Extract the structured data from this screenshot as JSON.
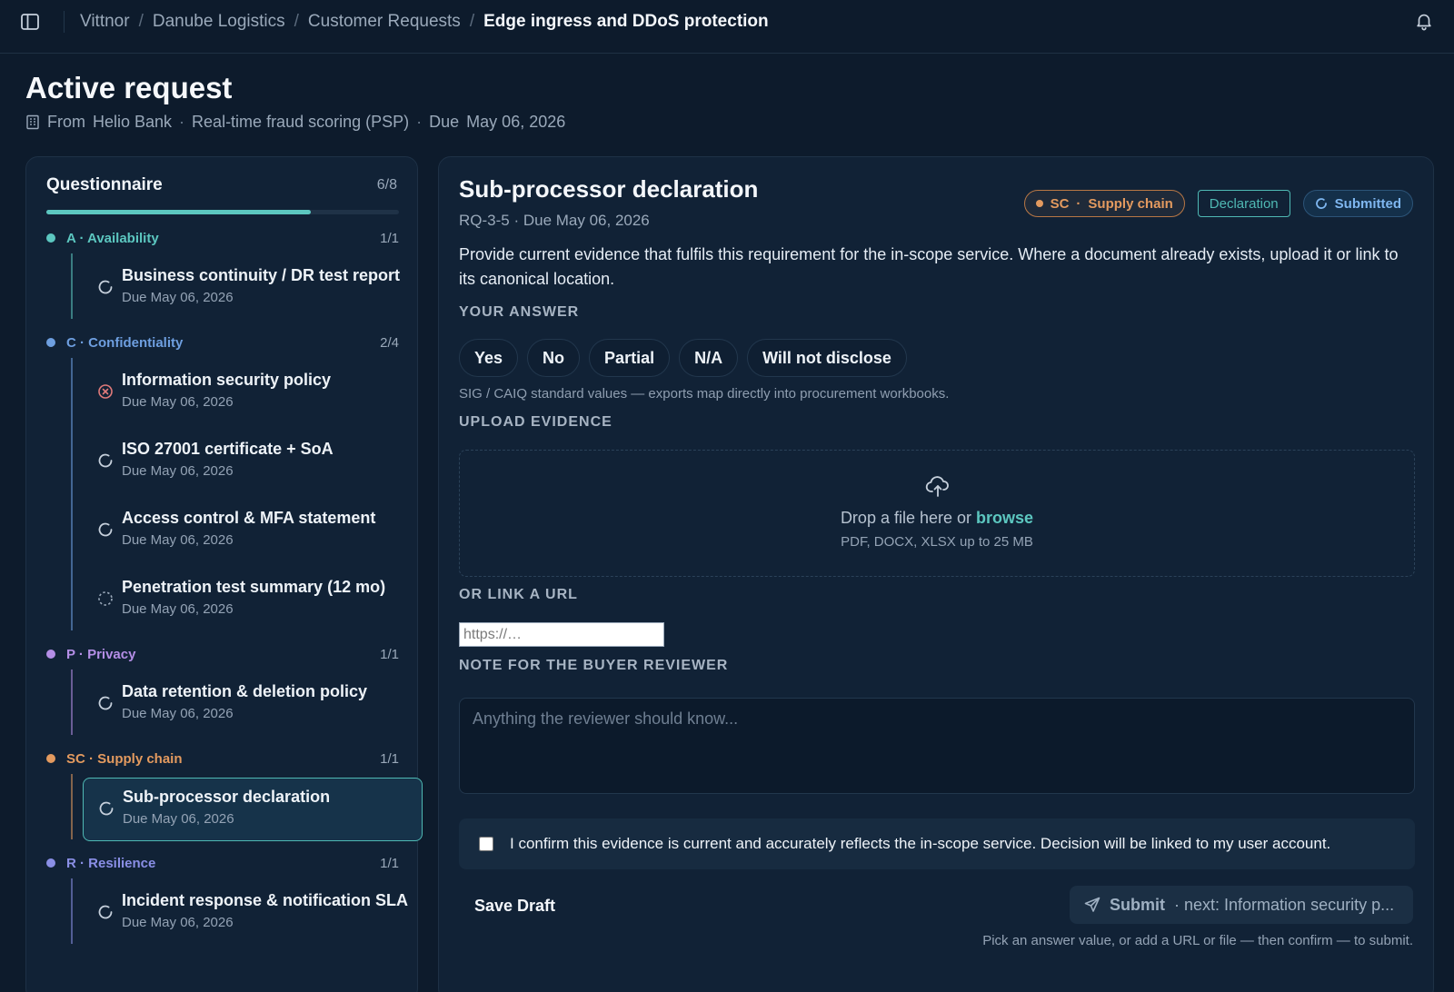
{
  "topbar": {
    "breadcrumbs": [
      "Vittnor",
      "Danube Logistics",
      "Customer Requests"
    ],
    "current": "Edge ingress and DDoS protection"
  },
  "header": {
    "title": "Active request",
    "from_label": "From",
    "from_value": "Helio Bank",
    "service": "Real-time fraud scoring (PSP)",
    "due_label": "Due",
    "due_value": "May 06, 2026"
  },
  "questionnaire": {
    "title": "Questionnaire",
    "count": "6/8",
    "progress": 0.75,
    "groups": [
      {
        "label": "A · Availability",
        "count": "1/1",
        "color": "#5cc7c0",
        "items": [
          {
            "title": "Business continuity / DR test report",
            "due": "Due May 06, 2026",
            "icon": "spinner-icon"
          }
        ]
      },
      {
        "label": "C · Confidentiality",
        "count": "2/4",
        "color": "#6e9fe0",
        "items": [
          {
            "title": "Information security policy",
            "due": "Due May 06, 2026",
            "icon": "x-circle-icon"
          },
          {
            "title": "ISO 27001 certificate + SoA",
            "due": "Due May 06, 2026",
            "icon": "spinner-icon"
          },
          {
            "title": "Access control & MFA statement",
            "due": "Due May 06, 2026",
            "icon": "spinner-icon"
          },
          {
            "title": "Penetration test summary (12 mo)",
            "due": "Due May 06, 2026",
            "icon": "dashed-circle-icon"
          }
        ]
      },
      {
        "label": "P · Privacy",
        "count": "1/1",
        "color": "#b48ee6",
        "items": [
          {
            "title": "Data retention & deletion policy",
            "due": "Due May 06, 2026",
            "icon": "spinner-icon"
          }
        ]
      },
      {
        "label": "SC · Supply chain",
        "count": "1/1",
        "color": "#e39a5f",
        "items": [
          {
            "title": "Sub-processor declaration",
            "due": "Due May 06, 2026",
            "icon": "spinner-icon",
            "active": true
          }
        ]
      },
      {
        "label": "R · Resilience",
        "count": "1/1",
        "color": "#8a8fe6",
        "items": [
          {
            "title": "Incident response & notification SLA",
            "due": "Due May 06, 2026",
            "icon": "spinner-icon"
          }
        ]
      }
    ]
  },
  "detail": {
    "title": "Sub-processor declaration",
    "meta": "RQ-3-5 · Due May 06, 2026",
    "tag_sc_code": "SC",
    "tag_sc_sep": "·",
    "tag_sc_name": "Supply chain",
    "tag_type": "Declaration",
    "tag_status": "Submitted",
    "description": "Provide current evidence that fulfils this requirement for the in-scope service. Where a document already exists, upload it or link to its canonical location.",
    "answer_label": "YOUR ANSWER",
    "answers": [
      "Yes",
      "No",
      "Partial",
      "N/A",
      "Will not disclose"
    ],
    "answers_hint": "SIG / CAIQ standard values — exports map directly into procurement workbooks.",
    "upload_label": "UPLOAD EVIDENCE",
    "drop_text": "Drop a file here or",
    "browse": "browse",
    "drop_hint": "PDF, DOCX, XLSX up to 25 MB",
    "url_label": "OR LINK A URL",
    "url_placeholder": "https://…",
    "url_value": "",
    "note_label": "NOTE FOR THE BUYER REVIEWER",
    "note_placeholder": "Anything the reviewer should know...",
    "note_value": "",
    "confirm_text": "I confirm this evidence is current and accurately reflects the in-scope service. Decision will be linked to my user account.",
    "confirm_checked": false,
    "save_draft": "Save Draft",
    "submit_main": "Submit",
    "submit_next": "· next: Information security p...",
    "submit_hint": "Pick an answer value, or add a URL or file — then confirm — to submit."
  }
}
